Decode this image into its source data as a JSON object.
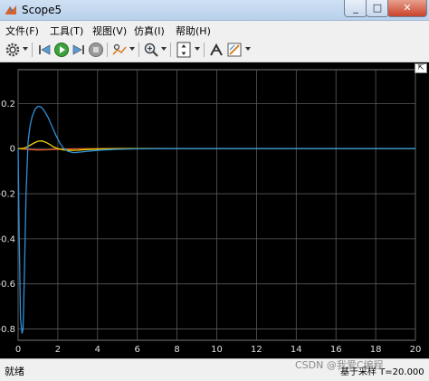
{
  "window": {
    "title": "Scope5",
    "close_glyph": "✕",
    "max_glyph": "□",
    "min_glyph": "_"
  },
  "menu": [
    {
      "label": "文件(F)"
    },
    {
      "label": "工具(T)"
    },
    {
      "label": "视图(V)"
    },
    {
      "label": "仿真(I)"
    },
    {
      "label": "帮助(H)"
    }
  ],
  "toolbar": {
    "icons": [
      "settings-icon",
      "step-back-icon",
      "run-icon",
      "step-forward-icon",
      "stop-icon",
      "highlight-icon",
      "zoom-in-icon",
      "scale-axes-icon",
      "cursor-measure-icon",
      "style-icon"
    ]
  },
  "chart_data": {
    "type": "line",
    "xlim": [
      0,
      20
    ],
    "ylim": [
      -0.85,
      0.35
    ],
    "x_ticks": [
      "0",
      "2",
      "4",
      "6",
      "8",
      "10",
      "12",
      "14",
      "16",
      "18",
      "20"
    ],
    "y_ticks": [
      "0.2",
      "0",
      "-0.2",
      "-0.4",
      "-0.6",
      "-0.8"
    ],
    "grid": true,
    "background": "#000000",
    "grid_color": "#5a5a5a",
    "series": [
      {
        "color": "#2e8fd8",
        "x": [
          0,
          0.05,
          0.12,
          0.2,
          0.25,
          0.32,
          0.4,
          0.5,
          0.6,
          0.7,
          0.85,
          1.0,
          1.15,
          1.3,
          1.5,
          1.7,
          1.9,
          2.1,
          2.3,
          2.5,
          2.8,
          3.2,
          3.7,
          4.3,
          5,
          6,
          8,
          10,
          12,
          14,
          16,
          18,
          20
        ],
        "y": [
          0,
          -0.35,
          -0.75,
          -0.82,
          -0.8,
          -0.55,
          -0.2,
          0.03,
          0.1,
          0.14,
          0.175,
          0.188,
          0.185,
          0.17,
          0.14,
          0.1,
          0.06,
          0.025,
          0.0,
          -0.012,
          -0.018,
          -0.015,
          -0.01,
          -0.006,
          -0.003,
          -0.001,
          0,
          0,
          0,
          0,
          0,
          0,
          0
        ]
      },
      {
        "color": "#e8d000",
        "x": [
          0,
          0.2,
          0.4,
          0.6,
          0.8,
          1.0,
          1.2,
          1.4,
          1.6,
          1.8,
          2.0,
          2.3,
          2.6,
          3.0,
          3.5,
          4.0,
          5,
          6,
          8,
          10,
          12,
          14,
          16,
          18,
          20
        ],
        "y": [
          0,
          0.0,
          0.005,
          0.015,
          0.025,
          0.033,
          0.034,
          0.028,
          0.018,
          0.007,
          0.0,
          -0.006,
          -0.008,
          -0.007,
          -0.004,
          -0.002,
          0,
          0,
          0,
          0,
          0,
          0,
          0,
          0,
          0
        ]
      },
      {
        "color": "#e8552a",
        "x": [
          0,
          0.5,
          1,
          1.5,
          2,
          3,
          5,
          8,
          12,
          16,
          20
        ],
        "y": [
          0,
          -0.004,
          -0.006,
          -0.005,
          -0.003,
          -0.001,
          0,
          0,
          0,
          0,
          0
        ]
      }
    ]
  },
  "status": {
    "left": "就绪",
    "right": "基于采样 T=20.000"
  },
  "watermark": "CSDN @我爱C编程"
}
